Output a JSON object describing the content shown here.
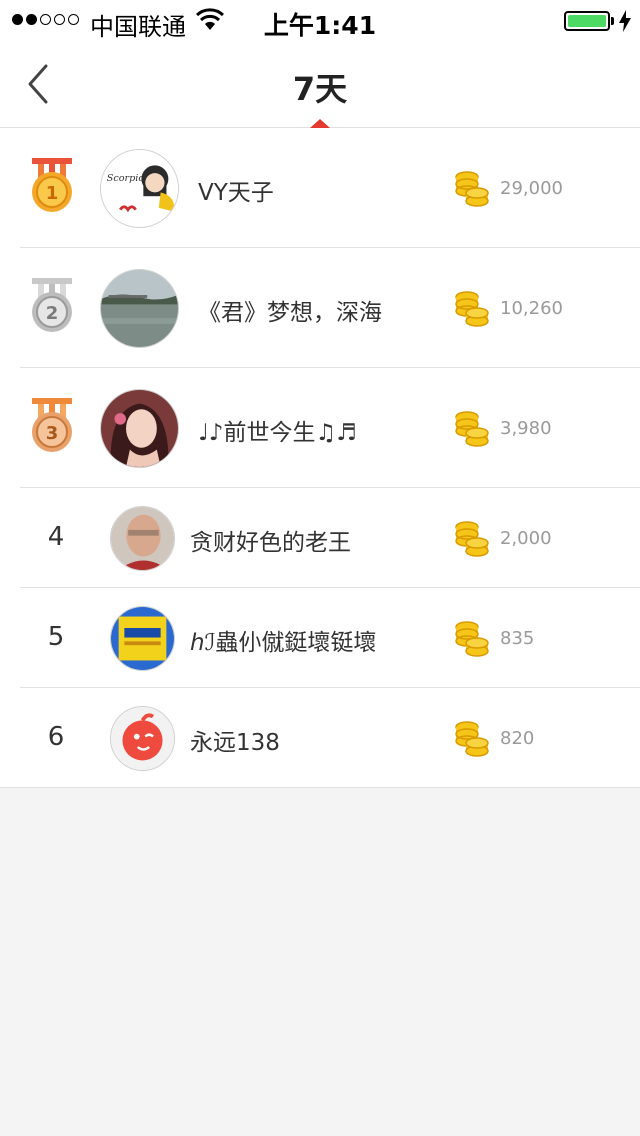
{
  "status_bar": {
    "carrier": "中国联通",
    "time": "上午1:41",
    "signal_dots_filled": 2,
    "signal_dots_total": 5,
    "battery_level": 1.0,
    "battery_color": "#4cd964"
  },
  "nav": {
    "title": "7天",
    "back_icon": "chevron-left-icon",
    "accent": "#e5392d"
  },
  "ranking": [
    {
      "rank": "1",
      "medal": "gold",
      "name": "VY天子",
      "coins": "29,000"
    },
    {
      "rank": "2",
      "medal": "silver",
      "name": "《君》梦想，深海",
      "coins": "10,260"
    },
    {
      "rank": "3",
      "medal": "bronze",
      "name": "♩♪前世今生♫♬",
      "coins": "3,980"
    },
    {
      "rank": "4",
      "medal": null,
      "name": "贪财好色的老王",
      "coins": "2,000"
    },
    {
      "rank": "5",
      "medal": null,
      "name": "ℎℐ蟲仦僦鋌壞铤壞",
      "coins": "835"
    },
    {
      "rank": "6",
      "medal": null,
      "name": "永远138",
      "coins": "820"
    }
  ],
  "icons": {
    "coin": "coin-stack-icon",
    "medal": "medal-icon"
  }
}
